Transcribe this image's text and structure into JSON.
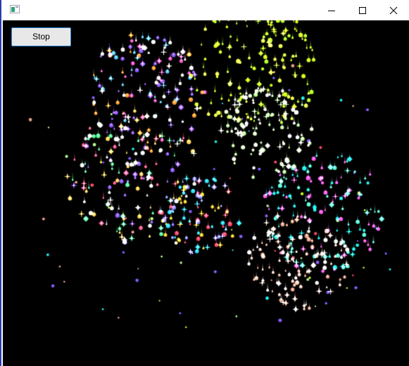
{
  "window": {
    "title": "",
    "controls": {
      "minimize": "minimize-icon",
      "maximize": "maximize-icon",
      "close": "close-icon"
    }
  },
  "toolbar": {
    "stop_label": "Stop"
  },
  "fireworks": {
    "background": "#000000",
    "bursts": [
      {
        "colors": [
          "#8a5cff",
          "#ff5cc8",
          "#5cc8ff",
          "#ffffff",
          "#ff9a3c"
        ],
        "size": 0.9
      },
      {
        "colors": [
          "#c8ff1e",
          "#eaff4a",
          "#a8ff2a"
        ],
        "size": 1.0
      },
      {
        "colors": [
          "#b8ff9a",
          "#e6ffd0",
          "#ffffff"
        ],
        "size": 0.7
      },
      {
        "colors": [
          "#8a5cff",
          "#ff5c8a",
          "#ffd25c",
          "#5cff9a",
          "#ffffff"
        ],
        "size": 1.0
      },
      {
        "colors": [
          "#22f0f0",
          "#5cffd8",
          "#ff5cf0"
        ],
        "size": 0.9
      },
      {
        "colors": [
          "#e8a08a",
          "#ffd0c0",
          "#ffffff"
        ],
        "size": 0.75
      },
      {
        "colors": [
          "#ff4a6a",
          "#8a8aff",
          "#ffcc33",
          "#33ddff"
        ],
        "size": 0.6
      }
    ]
  }
}
